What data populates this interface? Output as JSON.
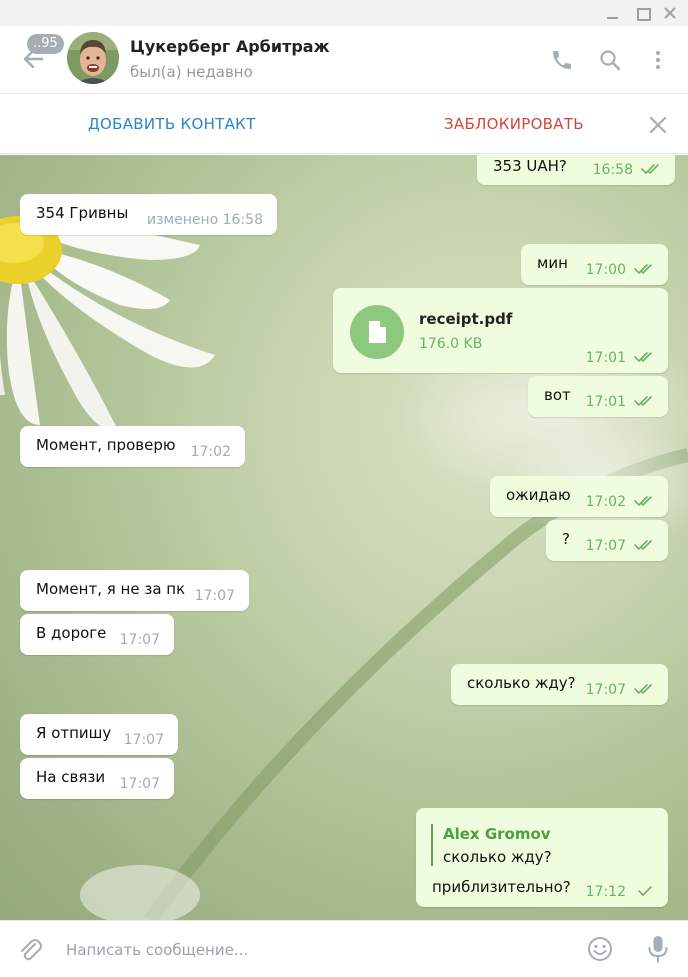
{
  "header": {
    "unread_badge": "..95",
    "chat_title": "Цукерберг Арбитраж",
    "status": "был(а) недавно"
  },
  "actionbar": {
    "add_contact": "ДОБАВИТЬ КОНТАКТ",
    "block": "ЗАБЛОКИРОВАТЬ"
  },
  "messages": [
    {
      "dir": "out",
      "text": "353  UAH?",
      "time": "16:58",
      "status": "read"
    },
    {
      "dir": "in",
      "text": "354 Гривны",
      "time": "изменено 16:58"
    },
    {
      "dir": "out",
      "text": "мин",
      "time": "17:00",
      "status": "read"
    },
    {
      "dir": "out",
      "type": "file",
      "file_name": "receipt.pdf",
      "file_size": "176.0 KB",
      "time": "17:01",
      "status": "read"
    },
    {
      "dir": "out",
      "text": "вот",
      "time": "17:01",
      "status": "read"
    },
    {
      "dir": "in",
      "text": "Момент, проверю",
      "time": "17:02"
    },
    {
      "dir": "out",
      "text": "ожидаю",
      "time": "17:02",
      "status": "read"
    },
    {
      "dir": "out",
      "text": "?",
      "time": "17:07",
      "status": "read"
    },
    {
      "dir": "in",
      "text": "Момент, я не за пк",
      "time": "17:07"
    },
    {
      "dir": "in",
      "text": "В дороге",
      "time": "17:07"
    },
    {
      "dir": "out",
      "text": "сколько жду?",
      "time": "17:07",
      "status": "read"
    },
    {
      "dir": "in",
      "text": "Я отпишу",
      "time": "17:07"
    },
    {
      "dir": "in",
      "text": "На связи",
      "time": "17:07"
    },
    {
      "dir": "out",
      "type": "reply",
      "reply_author": "Alex Gromov",
      "reply_text": "сколько жду?",
      "text": "приблизительно?",
      "time": "17:12",
      "status": "sent"
    }
  ],
  "composer": {
    "placeholder": "Написать сообщение..."
  },
  "colors": {
    "accent": "#2a84c7",
    "danger": "#d0463d",
    "outgoing_bubble": "#effdde",
    "read_ticks": "#6cb265"
  }
}
